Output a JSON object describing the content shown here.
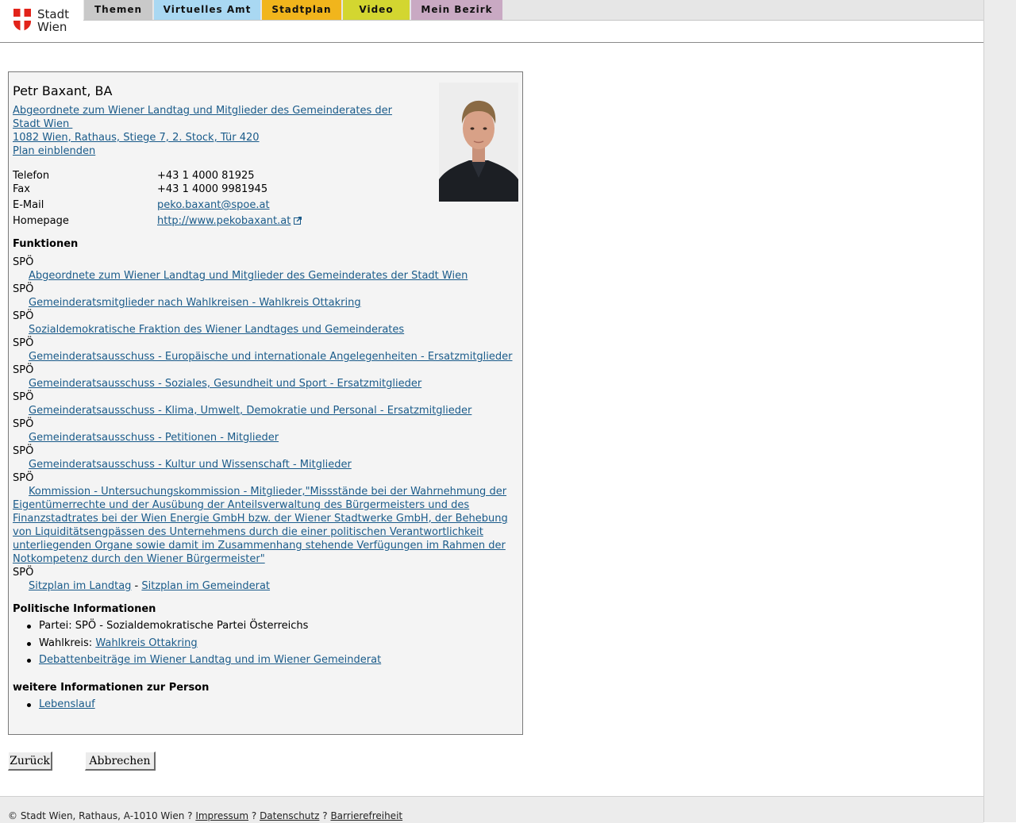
{
  "site": {
    "logo_line1": "Stadt",
    "logo_line2": "Wien",
    "logo_colors": {
      "red": "#e2231a"
    }
  },
  "nav": {
    "tabs": [
      {
        "label": "Themen",
        "color": "#c9c9c9"
      },
      {
        "label": "Virtuelles Amt",
        "color": "#a9d8f2"
      },
      {
        "label": "Stadtplan",
        "color": "#f1b51c"
      },
      {
        "label": "Video",
        "color": "#d3d630"
      },
      {
        "label": "Mein Bezirk",
        "color": "#c9a9c3"
      }
    ]
  },
  "person": {
    "name": "Petr Baxant, BA",
    "role_link_line1": "Abgeordnete zum Wiener Landtag und Mitglieder des Gemeinderates der",
    "role_link_line2": "Stadt Wien ",
    "address": "1082 Wien, Rathaus, Stiege 7, 2. Stock, Tür 420",
    "plan_link": "Plan einblenden"
  },
  "contact": {
    "telefon_label": "Telefon",
    "telefon_value": "+43 1 4000 81925",
    "fax_label": "Fax",
    "fax_value": "+43 1 4000 9981945",
    "email_label": "E-Mail",
    "email_value": "peko.baxant@spoe.at",
    "homepage_label": "Homepage",
    "homepage_value": "http://www.pekobaxant.at"
  },
  "funktionen": {
    "heading": "Funktionen",
    "items": [
      {
        "party": "SPÖ",
        "link": "Abgeordnete zum Wiener Landtag und Mitglieder des Gemeinderates der Stadt Wien"
      },
      {
        "party": "SPÖ",
        "link": "Gemeinderatsmitglieder nach Wahlkreisen - Wahlkreis Ottakring"
      },
      {
        "party": "SPÖ",
        "link": "Sozialdemokratische Fraktion des Wiener Landtages und Gemeinderates"
      },
      {
        "party": "SPÖ",
        "link": "Gemeinderatsausschuss - Europäische und internationale Angelegenheiten - Ersatzmitglieder"
      },
      {
        "party": "SPÖ",
        "link": "Gemeinderatsausschuss - Soziales, Gesundheit und Sport - Ersatzmitglieder"
      },
      {
        "party": "SPÖ",
        "link": "Gemeinderatsausschuss - Klima, Umwelt, Demokratie und Personal - Ersatzmitglieder"
      },
      {
        "party": "SPÖ",
        "link": "Gemeinderatsausschuss - Petitionen - Mitglieder"
      },
      {
        "party": "SPÖ",
        "link": "Gemeinderatsausschuss - Kultur und Wissenschaft - Mitglieder"
      },
      {
        "party": "SPÖ",
        "link_lines": [
          "Kommission - Untersuchungskommission - Mitglieder,\"Missstände bei der Wahrnehmung der",
          "Eigentümerrechte und der Ausübung der Anteilsverwaltung des Bürgermeisters und des",
          "Finanzstadtrates bei der Wien Energie GmbH bzw. der Wiener Stadtwerke GmbH, der Behebung",
          "von Liquiditätsengpässen des Unternehmens durch die einer politischen Verantwortlichkeit",
          "unterliegenden Organe sowie damit im Zusammenhang stehende Verfügungen im Rahmen der",
          "Notkompetenz durch den Wiener Bürgermeister\""
        ]
      },
      {
        "party": "SPÖ",
        "link_a": "Sitzplan im Landtag",
        "separator": " - ",
        "link_b": "Sitzplan im Gemeinderat"
      }
    ]
  },
  "politisch": {
    "heading": "Politische Informationen",
    "partei": "Partei: SPÖ - Sozialdemokratische Partei Österreichs",
    "wahlkreis_label": "Wahlkreis: ",
    "wahlkreis_link": "Wahlkreis Ottakring",
    "debatten_link": "Debattenbeiträge im Wiener Landtag und im Wiener Gemeinderat"
  },
  "weitere": {
    "heading": "weitere Informationen zur Person",
    "lebenslauf": "Lebenslauf"
  },
  "buttons": {
    "back": "Zurück",
    "cancel": "Abbrechen"
  },
  "footer": {
    "copyright": "© Stadt Wien, Rathaus, A-1010 Wien ",
    "sep": "?",
    "impressum": "Impressum",
    "datenschutz": "Datenschutz",
    "barrierefreiheit": "Barrierefreiheit"
  }
}
